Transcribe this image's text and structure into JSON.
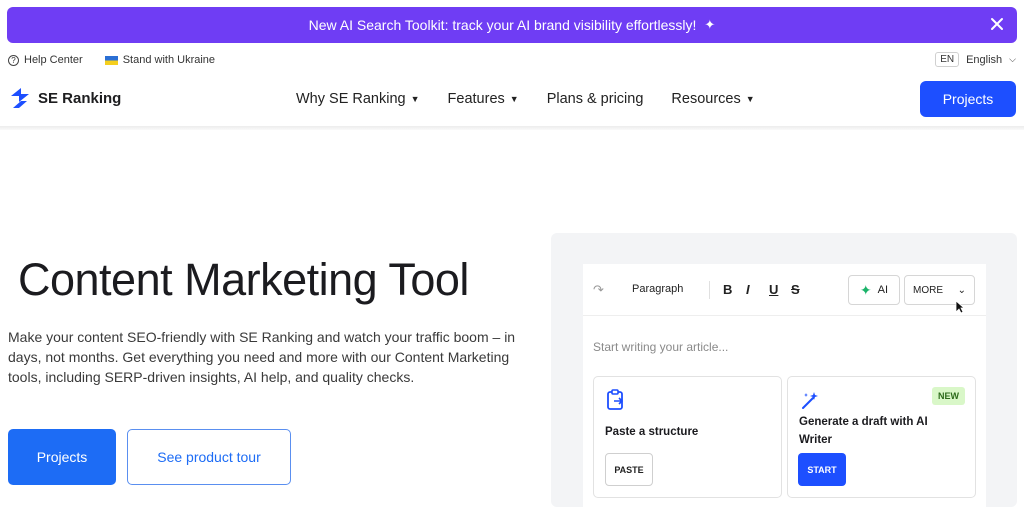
{
  "promo": {
    "text": "New AI Search Toolkit: track your AI brand visibility effortlessly!",
    "sparkle": "✦"
  },
  "util": {
    "help": "Help Center",
    "ukraine": "Stand with Ukraine",
    "lang_code": "EN",
    "lang_name": "English"
  },
  "header": {
    "logo": "SE Ranking",
    "nav": [
      {
        "label": "Why SE Ranking",
        "chevron": "⌄"
      },
      {
        "label": "Features",
        "chevron": "⌄"
      },
      {
        "label": "Plans & pricing",
        "chevron": ""
      },
      {
        "label": "Resources",
        "chevron": "⌄"
      }
    ],
    "projects": "Projects"
  },
  "hero": {
    "title": "Content Marketing Tool",
    "description": "Make your content SEO-friendly with SE Ranking and watch your traffic boom – in days, not months. Get everything you need and more with our Content Marketing tools, including SERP-driven insights, AI help, and quality checks.",
    "primary_button": "Projects",
    "secondary_button": "See product tour"
  },
  "editor": {
    "paragraph": "Paragraph",
    "bold": "B",
    "italic": "I",
    "underline": "U",
    "strike": "S",
    "ai": "AI",
    "more": "MORE",
    "placeholder": "Start writing your article...",
    "card1": {
      "title": "Paste a structure",
      "button": "PASTE"
    },
    "card2": {
      "title": "Generate a draft with AI Writer",
      "button": "START",
      "badge": "NEW"
    }
  },
  "colors": {
    "promo": "#6f3df4",
    "primary": "#1d4fff",
    "accent_blue": "#1d6cf5"
  }
}
